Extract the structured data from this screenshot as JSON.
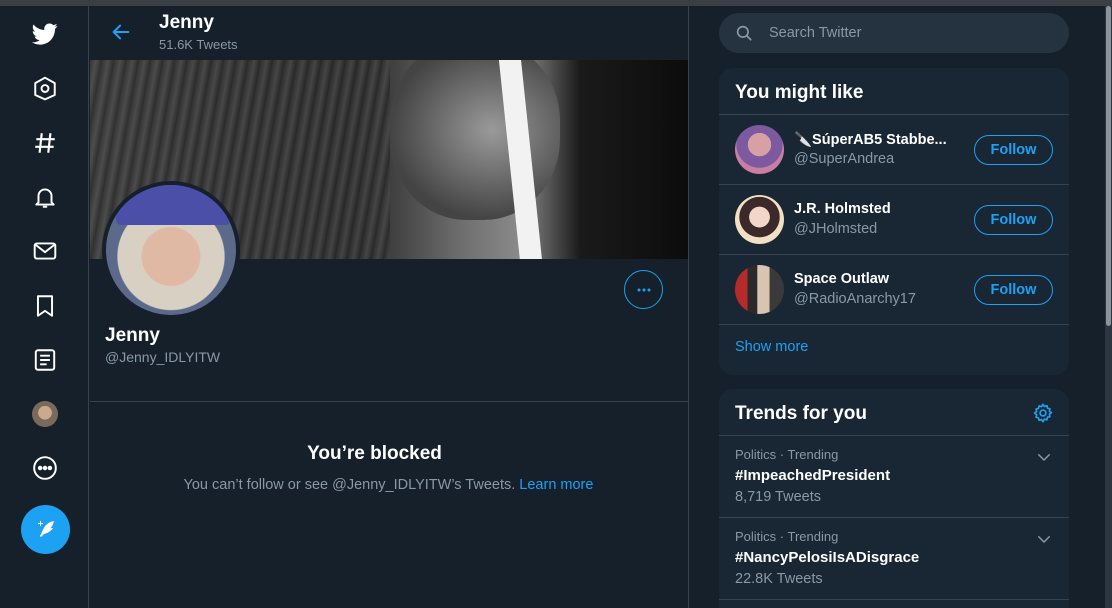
{
  "colors": {
    "background": "#15202b",
    "panel": "#192734",
    "accent": "#1da1f2",
    "muted": "#8899a6",
    "border": "#38444d"
  },
  "nav": {
    "items": [
      {
        "name": "twitter-logo-icon"
      },
      {
        "name": "home-icon"
      },
      {
        "name": "explore-icon"
      },
      {
        "name": "notifications-icon"
      },
      {
        "name": "messages-icon"
      },
      {
        "name": "bookmarks-icon"
      },
      {
        "name": "lists-icon"
      },
      {
        "name": "profile-avatar-icon"
      },
      {
        "name": "more-icon"
      },
      {
        "name": "compose-tweet-icon"
      }
    ]
  },
  "header": {
    "name": "Jenny",
    "tweet_count": "51.6K Tweets"
  },
  "profile": {
    "name": "Jenny",
    "handle": "@Jenny_IDLYITW"
  },
  "blocked": {
    "title": "You’re blocked",
    "message": "You can’t follow or see @Jenny_IDLYITW’s Tweets.",
    "link": "Learn more"
  },
  "search": {
    "placeholder": "Search Twitter"
  },
  "who_to_follow": {
    "title": "You might like",
    "users": [
      {
        "name": "🔪SúperAB5 Stabbe...",
        "handle": "@SuperAndrea",
        "button": "Follow"
      },
      {
        "name": "J.R. Holmsted",
        "handle": "@JHolmsted",
        "button": "Follow"
      },
      {
        "name": "Space Outlaw",
        "handle": "@RadioAnarchy17",
        "button": "Follow"
      }
    ],
    "show_more": "Show more"
  },
  "trends": {
    "title": "Trends for you",
    "items": [
      {
        "meta": "Politics · Trending",
        "tag": "#ImpeachedPresident",
        "count": "8,719 Tweets"
      },
      {
        "meta": "Politics · Trending",
        "tag": "#NancyPelosiIsADisgrace",
        "count": "22.8K Tweets"
      }
    ]
  }
}
